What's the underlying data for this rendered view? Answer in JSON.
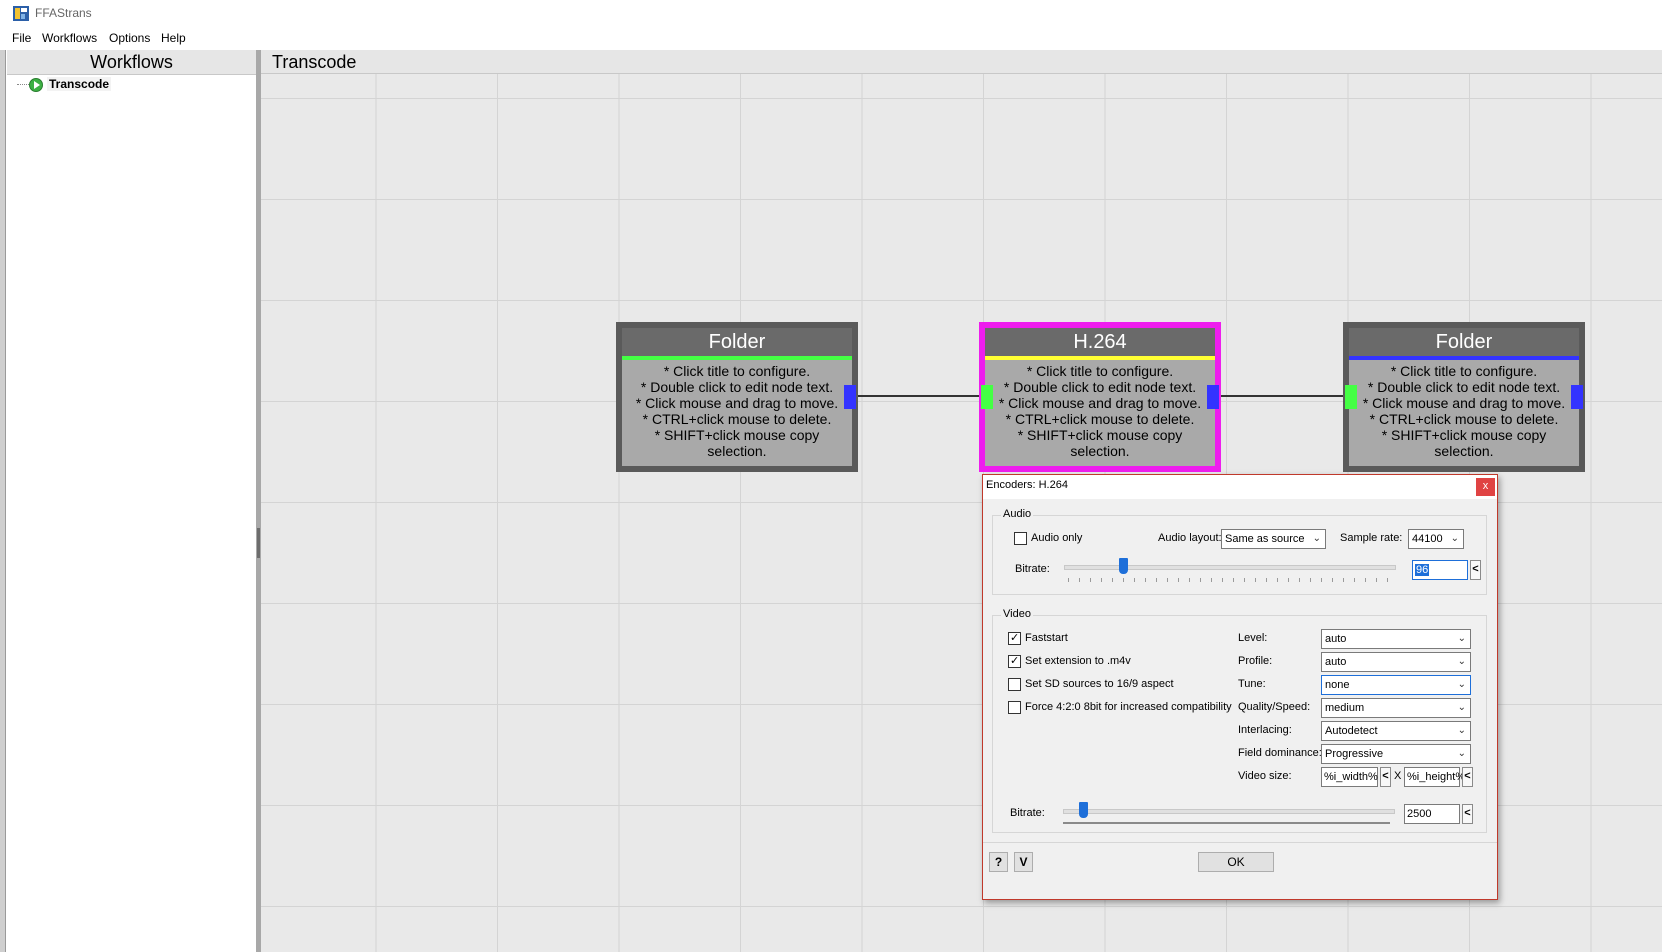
{
  "app": {
    "title": "FFAStrans"
  },
  "menu": {
    "file": "File",
    "workflows": "Workflows",
    "options": "Options",
    "help": "Help"
  },
  "side_panel": {
    "title": "Workflows",
    "items": [
      {
        "label": "Transcode"
      }
    ]
  },
  "canvas": {
    "title": "Transcode"
  },
  "nodes": [
    {
      "title": "Folder",
      "bar_color": "#44ff44",
      "lines": [
        "* Click title to configure.",
        "* Double click to edit node text.",
        "* Click mouse and drag to move.",
        "* CTRL+click mouse to delete.",
        "* SHIFT+click mouse copy",
        "selection."
      ]
    },
    {
      "title": "H.264",
      "bar_color": "#ffff33",
      "lines": [
        "* Click title to configure.",
        "* Double click to edit node text.",
        "* Click mouse and drag to move.",
        "* CTRL+click mouse to delete.",
        "* SHIFT+click mouse copy",
        "selection."
      ]
    },
    {
      "title": "Folder",
      "bar_color": "#3333ff",
      "lines": [
        "* Click title to configure.",
        "* Double click to edit node text.",
        "* Click mouse and drag to move.",
        "* CTRL+click mouse to delete.",
        "* SHIFT+click mouse copy",
        "selection."
      ]
    }
  ],
  "dialog": {
    "title": "Encoders: H.264",
    "close": "x",
    "audio": {
      "group_label": "Audio",
      "audio_only_label": "Audio only",
      "audio_only_checked": false,
      "layout_label": "Audio layout:",
      "layout_value": "Same as source",
      "sample_rate_label": "Sample rate:",
      "sample_rate_value": "44100",
      "bitrate_label": "Bitrate:",
      "bitrate_value": "96",
      "bitrate_slider_fraction": 0.17,
      "nudge": "<"
    },
    "video": {
      "group_label": "Video",
      "checkboxes": [
        {
          "label": "Faststart",
          "checked": true
        },
        {
          "label": "Set extension to .m4v",
          "checked": true
        },
        {
          "label": "Set SD sources to 16/9 aspect",
          "checked": false
        },
        {
          "label": "Force 4:2:0 8bit for increased compatibility",
          "checked": false
        }
      ],
      "fields": [
        {
          "label": "Level:",
          "value": "auto"
        },
        {
          "label": "Profile:",
          "value": "auto"
        },
        {
          "label": "Tune:",
          "value": "none"
        },
        {
          "label": "Quality/Speed:",
          "value": "medium"
        },
        {
          "label": "Interlacing:",
          "value": "Autodetect"
        },
        {
          "label": "Field dominance:",
          "value": "Progressive"
        }
      ],
      "video_size_label": "Video size:",
      "width_value": "%i_width%",
      "height_value": "%i_height%",
      "size_sep": "X",
      "bitrate_label": "Bitrate:",
      "bitrate_value": "2500",
      "bitrate_slider_fraction": 0.05,
      "nudge": "<"
    },
    "footer": {
      "help": "?",
      "v": "V",
      "ok": "OK"
    }
  }
}
